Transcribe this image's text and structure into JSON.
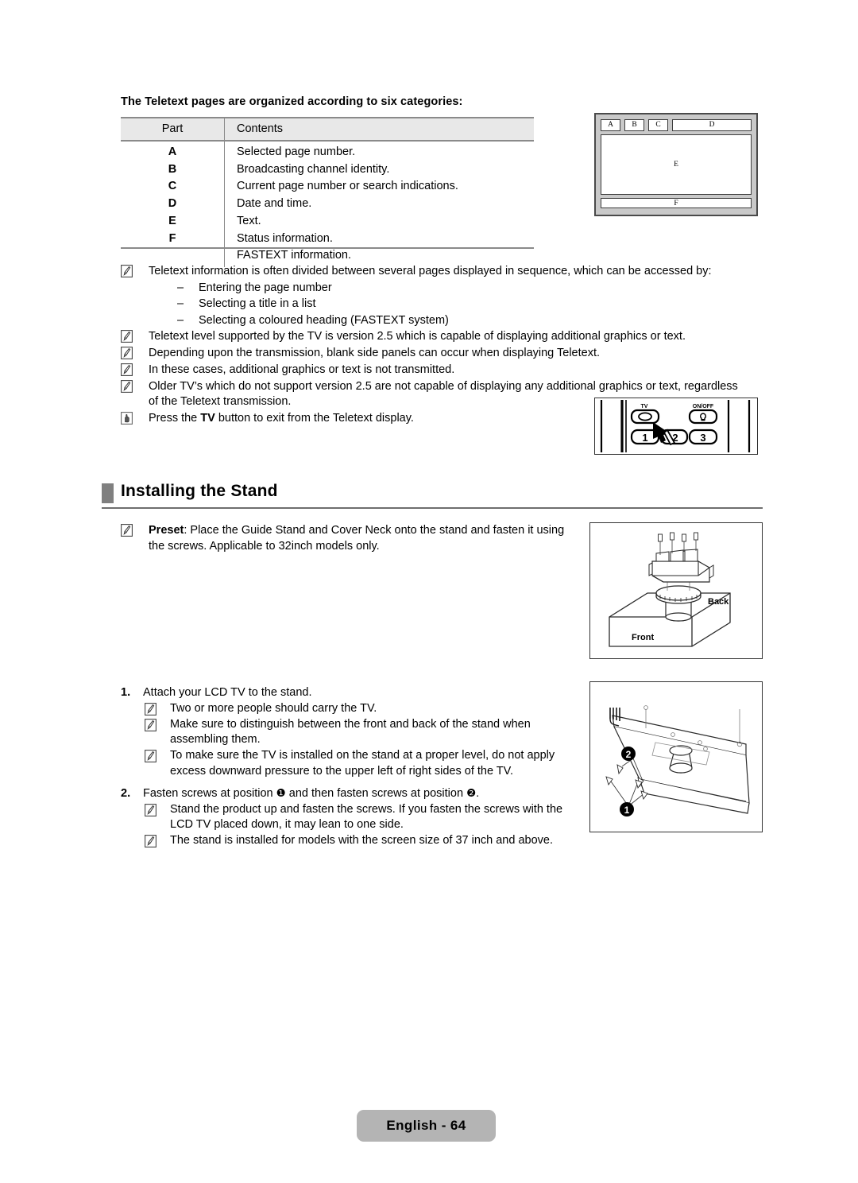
{
  "intro": {
    "line": "The Teletext pages are organized according to six categories:"
  },
  "table": {
    "headers": [
      "Part",
      "Contents"
    ],
    "rows": [
      {
        "part": "A",
        "contents": "Selected page number."
      },
      {
        "part": "B",
        "contents": "Broadcasting channel identity."
      },
      {
        "part": "C",
        "contents": "Current page number or search indications."
      },
      {
        "part": "D",
        "contents": "Date and time."
      },
      {
        "part": "E",
        "contents": "Text."
      },
      {
        "part": "F",
        "contents": "Status information."
      },
      {
        "part": "",
        "contents": "FASTEXT information."
      }
    ]
  },
  "teletext_figure": {
    "label_a": "A",
    "label_b": "B",
    "label_c": "C",
    "label_d": "D",
    "label_e": "E",
    "label_f": "F"
  },
  "notes": [
    {
      "icon": "note-pencil-icon",
      "text": "Teletext information is often divided between several pages displayed in sequence, which can be accessed by:",
      "sub": [
        "Entering the page number",
        "Selecting a title in a list",
        "Selecting a coloured heading (FASTEXT system)"
      ]
    },
    {
      "icon": "note-pencil-icon",
      "text": "Teletext level supported by the TV is version 2.5 which is capable of displaying additional graphics or text.",
      "sub": []
    },
    {
      "icon": "note-pencil-icon",
      "text": "Depending upon the transmission, blank side panels can occur when displaying Teletext.",
      "sub": []
    },
    {
      "icon": "note-pencil-icon",
      "text": "In these cases, additional graphics or text is not transmitted.",
      "sub": []
    },
    {
      "icon": "note-pencil-icon",
      "text": "Older TV’s which do not support version 2.5 are not capable of displaying any additional graphics or text, regardless of the Teletext transmission.",
      "sub": []
    }
  ],
  "press_note": {
    "icon": "hand-press-icon",
    "before": "Press the ",
    "bold": "TV",
    "after": " button to exit from the Teletext display."
  },
  "remote_figure": {
    "label_tv": "TV",
    "label_onoff": "ON/OFF",
    "key_1": "1",
    "key_2": "2",
    "key_3": "3"
  },
  "section": {
    "title": "Installing the Stand"
  },
  "preset_note": {
    "icon": "note-pencil-icon",
    "bold": "Preset",
    "text": ": Place the Guide Stand and Cover Neck onto the stand and fasten it using the screws. Applicable to 32inch models only."
  },
  "stand_figure": {
    "label_back": "Back",
    "label_front": "Front"
  },
  "screws_figure": {
    "marker_1": "❶",
    "marker_2": "❷"
  },
  "steps": [
    {
      "num": "1.",
      "text": "Attach your LCD TV to the stand.",
      "notes": [
        "Two or more people should carry the TV.",
        "Make sure to distinguish between the front and back of the stand when assembling them.",
        "To make sure the TV is installed on the stand at a proper level, do not apply excess downward pressure to the upper left of right sides of the TV."
      ]
    },
    {
      "num": "2.",
      "text_part1": "Fasten screws at position ",
      "marker_1": "❶",
      "text_part2": " and then fasten screws at position ",
      "marker_2": "❷",
      "text_part3": ".",
      "notes": [
        "Stand the product up and fasten the screws. If you fasten the screws with the LCD TV placed down, it may lean to one side.",
        "The stand is installed for models with the screen size of 37 inch and above."
      ]
    }
  ],
  "footer": {
    "label": "English - 64"
  },
  "colors": {
    "header_fill": "#e8e8e8",
    "rule": "#8a8a8a",
    "heading_bar": "#808080",
    "footer_fill": "#b4b4b4",
    "figure_fill": "#c9c9c9"
  }
}
